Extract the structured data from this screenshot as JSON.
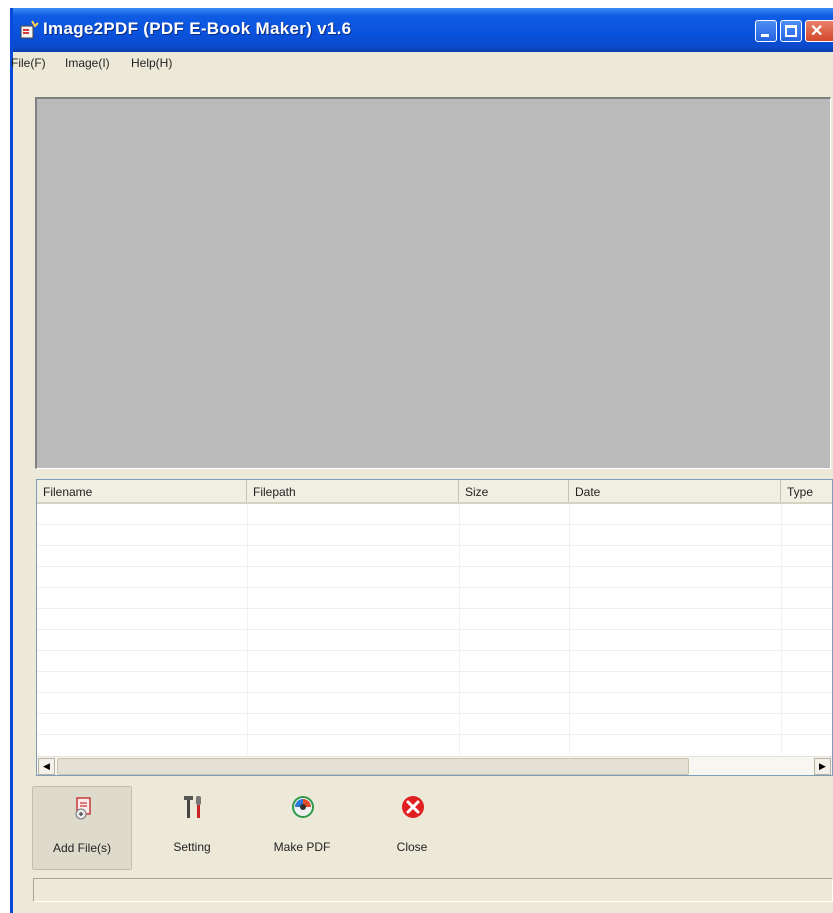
{
  "window": {
    "title": "Image2PDF (PDF E-Book Maker) v1.6",
    "app_icon": "app-pdf-icon"
  },
  "titlebar_controls": [
    "minimize-icon",
    "maximize-icon",
    "close-icon"
  ],
  "menu": {
    "items": [
      {
        "label": "File(F)"
      },
      {
        "label": "Image(I)"
      },
      {
        "label": "Help(H)"
      }
    ]
  },
  "file_list": {
    "columns": [
      {
        "label": "Filename"
      },
      {
        "label": "Filepath"
      },
      {
        "label": "Size"
      },
      {
        "label": "Date"
      },
      {
        "label": "Type"
      }
    ],
    "rows": []
  },
  "toolbar": {
    "buttons": [
      {
        "label": "Add File(s)",
        "icon": "add-file-icon",
        "active": true
      },
      {
        "label": "Setting",
        "icon": "tools-icon"
      },
      {
        "label": "Make PDF",
        "icon": "make-pdf-icon"
      },
      {
        "label": "Close",
        "icon": "close-circle-icon",
        "color": "#e02020"
      }
    ]
  },
  "colors": {
    "title_bar": "#0a52dc",
    "preview_background": "#bababa",
    "window_background": "#ece9d8"
  }
}
